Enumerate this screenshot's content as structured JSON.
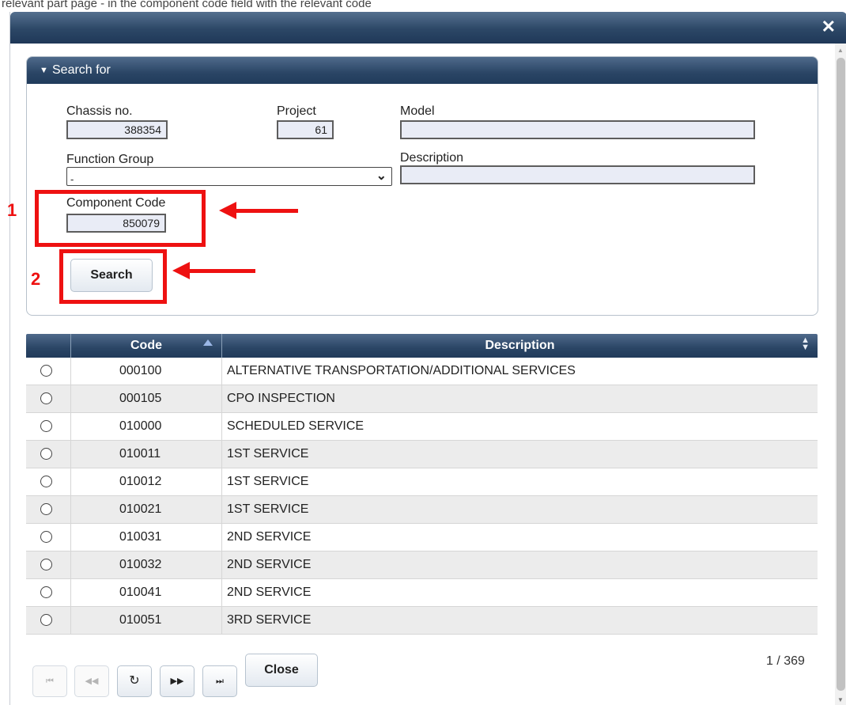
{
  "top_strip_text": "relevant part page - in the component code field with the relevant code",
  "dialog": {
    "close_icon": "close-icon"
  },
  "search_panel": {
    "title": "Search for",
    "chassis": {
      "label": "Chassis no.",
      "value": "388354"
    },
    "project": {
      "label": "Project",
      "value": "61"
    },
    "model": {
      "label": "Model",
      "value": ""
    },
    "function_group": {
      "label": "Function Group",
      "value": "-"
    },
    "description": {
      "label": "Description",
      "value": ""
    },
    "component_code": {
      "label": "Component Code",
      "value": "850079"
    },
    "search_label": "Search"
  },
  "annotations": {
    "step1": "1",
    "step2": "2",
    "color": "#ee1111"
  },
  "grid": {
    "columns": {
      "code": "Code",
      "description": "Description"
    },
    "rows": [
      {
        "code": "000100",
        "description": "ALTERNATIVE TRANSPORTATION/ADDITIONAL SERVICES"
      },
      {
        "code": "000105",
        "description": "CPO INSPECTION"
      },
      {
        "code": "010000",
        "description": "SCHEDULED SERVICE"
      },
      {
        "code": "010011",
        "description": "1ST SERVICE"
      },
      {
        "code": "010012",
        "description": "1ST SERVICE"
      },
      {
        "code": "010021",
        "description": "1ST SERVICE"
      },
      {
        "code": "010031",
        "description": "2ND SERVICE"
      },
      {
        "code": "010032",
        "description": "2ND SERVICE"
      },
      {
        "code": "010041",
        "description": "2ND SERVICE"
      },
      {
        "code": "010051",
        "description": "3RD SERVICE"
      }
    ]
  },
  "pager": {
    "first": "⏮",
    "prev": "◀◀",
    "refresh": "↻",
    "next": "▶▶",
    "last": "⏭",
    "close_label": "Close",
    "page_info": "1 / 369"
  }
}
